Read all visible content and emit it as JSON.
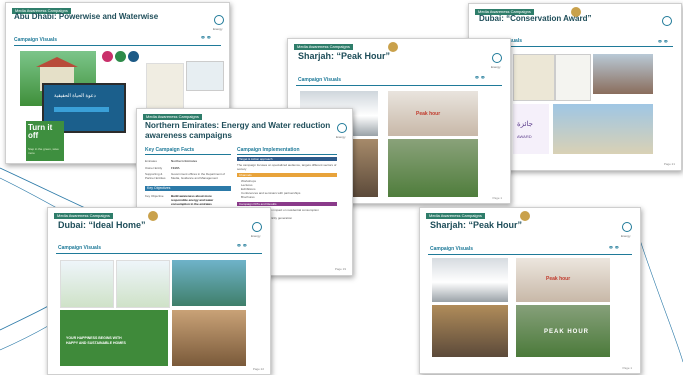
{
  "background": {
    "accent": "#2c7aa8"
  },
  "slides": {
    "abu_dhabi": {
      "tag": "Media Awareness Campaigns",
      "title": "Abu Dhabi: Powerwise and Waterwise",
      "section": "Campaign Visuals",
      "logo_label": "Energy",
      "turn_off": "Turn it off",
      "subtext": "Step in the green, save more",
      "arabic": "دعوة الحياة الحقيقية"
    },
    "dubai_conservation": {
      "tag": "Media Awareness Campaigns",
      "title": "Dubai: “Conservation Award”",
      "section": "Campaign Visuals",
      "page": "Page 21",
      "arabic_award": "جائزة",
      "award_en": "AWARD"
    },
    "sharjah_back": {
      "tag": "Media Awareness Campaigns",
      "title": "Sharjah: “Peak Hour”",
      "section": "Campaign Visuals",
      "logo_label": "Energy",
      "page": "Page 1",
      "banner": "Peak hour"
    },
    "northern": {
      "tag": "Media Awareness Campaigns",
      "title_line1": "Northern Emirates: Energy and Water reduction",
      "title_line2": "awareness campaigns",
      "left_heading": "Key Campaign Facts",
      "right_heading": "Campaign Implementation",
      "facts": [
        {
          "k": "Emirates",
          "v": "Northern Emirates"
        },
        {
          "k": "Owner Entity",
          "v": "FEWA"
        },
        {
          "k": "Supporting & Partner Entities",
          "v": "Government offices in the Department of Media, Guidance and Management"
        }
      ],
      "objective_heading": "Key Objectives",
      "objective_label": "Key Objective",
      "objective_text": "Build awareness about more responsible energy and water consumption in the emirates",
      "description_label": "Description",
      "description_text": "The aim of the initiative is to educate users",
      "impl_heading_1": "Target & Action approach",
      "impl_text_1": "The campaign focuses on specialized audience, targets different sectors of society",
      "impl_heading_2": "Channels",
      "impl_items": [
        "Workshops",
        "Lectures",
        "Exhibitions",
        "Conferences and seminars with partnerships",
        "Brochures"
      ],
      "impl_heading_3": "Campaign KPIs and Results",
      "kpi_text": "Actual awareness program impact on residential consumption",
      "kpi_text_2": "Reduction of water / electricity generation",
      "logo_label": "Energy",
      "page": "Page 19"
    },
    "dubai_ideal": {
      "tag": "Media Awareness Campaigns",
      "title": "Dubai: “Ideal Home”",
      "section": "Campaign Visuals",
      "logo_label": "Energy",
      "page": "Page 22",
      "banner": "YOUR HAPPINESS BEGINS WITH HAPPY AND SUSTAINABLE HOMES"
    },
    "sharjah_front": {
      "tag": "Media Awareness Campaigns",
      "title": "Sharjah: “Peak Hour”",
      "section": "Campaign Visuals",
      "logo_label": "Energy",
      "page": "Page 1",
      "banner": "Peak hour",
      "ground": "PEAK HOUR"
    }
  }
}
